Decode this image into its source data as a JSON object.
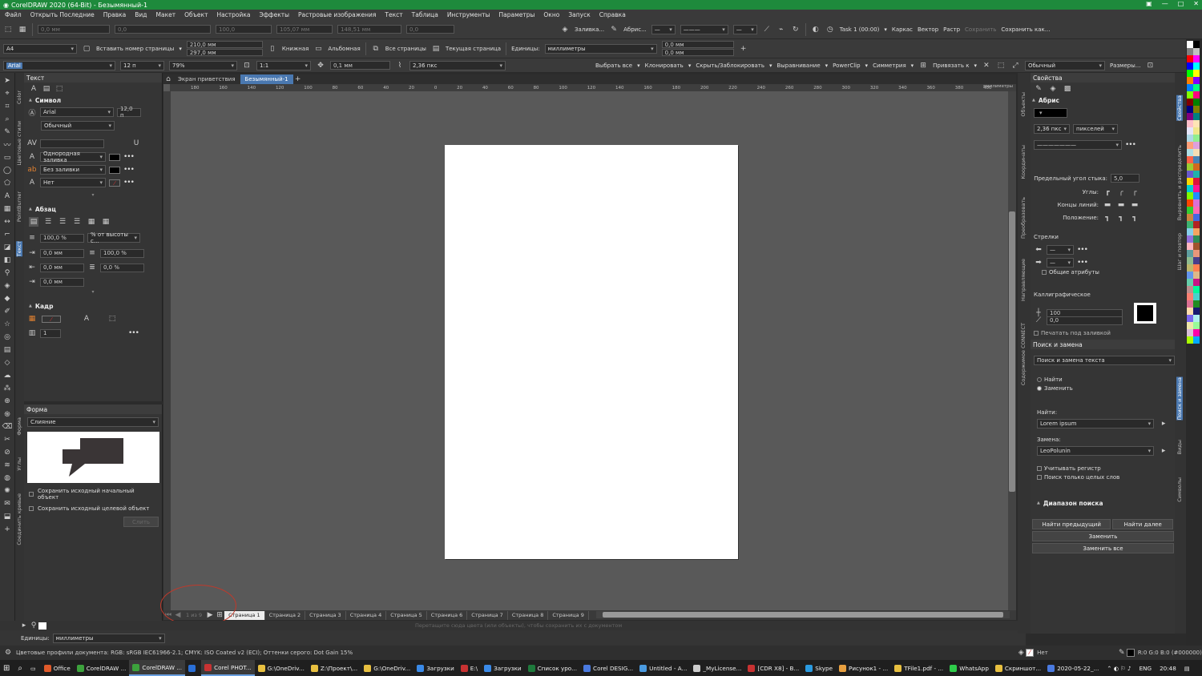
{
  "window": {
    "title": "CorelDRAW 2020 (64-Bit) - Безымянный-1"
  },
  "menu": [
    "Файл",
    "Открыть Последние",
    "Правка",
    "Вид",
    "Макет",
    "Объект",
    "Настройка",
    "Эффекты",
    "Растровые изображения",
    "Текст",
    "Таблица",
    "Инструменты",
    "Параметры",
    "Окно",
    "Запуск",
    "Справка"
  ],
  "toolbar1": {
    "fill": "Заливка...",
    "outline": "Абрис...",
    "task": "Task 1 (00:00)",
    "wireframe": "Каркас",
    "vector": "Вектор",
    "raster": "Растр",
    "save": "Сохранить",
    "save_as": "Сохранить как...",
    "x_mm": "0,0 мм",
    "w_mm": "100,0",
    "w2": "105,07 мм",
    "h2": "148,51 мм",
    "zero": "0,0"
  },
  "toolbar2": {
    "page_size": "A4",
    "insert_page_number": "Вставить номер страницы",
    "width": "210,0 мм",
    "height": "297,0 мм",
    "portrait": "Книжная",
    "landscape": "Альбомная",
    "all_pages": "Все страницы",
    "current_page": "Текущая страница",
    "units_label": "Единицы:",
    "units": "миллиметры",
    "nudge_x": "0,0 мм",
    "nudge_y": "0,0 мм"
  },
  "toolbar3": {
    "font": "Arial",
    "size": "12 п",
    "zoom": "79%",
    "scale": "1:1",
    "nudge": "0,1 мм",
    "outline_width": "2,36 пкс",
    "select_all": "Выбрать все",
    "clone": "Клонировать",
    "hide_lock": "Скрыть/Заблокировать",
    "align": "Выравнивание",
    "powerclip": "PowerClip",
    "symmetry": "Симметрия",
    "snap": "Привязать к",
    "style": "Обычный",
    "sizes": "Размеры..."
  },
  "left_panel": {
    "title": "Текст",
    "symbol": "Символ",
    "font": "Arial",
    "size": "12,0 п",
    "style": "Обычный",
    "fill1": "Однородная заливка",
    "fill2": "Без заливки",
    "fill3": "Нет",
    "paragraph": "Абзац",
    "spacing1": "100,0 %",
    "spacing_mode": "% от высоты с...",
    "indent1": "0,0 мм",
    "indent2": "0,0 мм",
    "indent3": "0,0 мм",
    "spacing2": "100,0 %",
    "spacing3": "0,0 %",
    "frame": "Кадр",
    "frame_cols": "1"
  },
  "form_panel": {
    "title": "Форма",
    "mode": "Слияние",
    "keep_source": "Сохранить исходный начальный объект",
    "keep_target": "Сохранить исходный целевой объект",
    "apply": "Слить"
  },
  "vtabs_left": [
    "Color",
    "Цветовые стили",
    "PointBurner",
    "Текст",
    "Форма",
    "Углы",
    "Соединить кривые"
  ],
  "doc_tabs": [
    "Экран приветствия",
    "Безымянный-1"
  ],
  "ruler_ticks": [
    "180",
    "160",
    "140",
    "120",
    "100",
    "80",
    "60",
    "40",
    "20",
    "0",
    "20",
    "40",
    "60",
    "80",
    "100",
    "120",
    "140",
    "160",
    "180",
    "200",
    "220",
    "240",
    "260",
    "280",
    "300",
    "320",
    "340",
    "360",
    "380",
    "400"
  ],
  "ruler_units": "миллиметры",
  "page_tabs": [
    "Страница 1",
    "Страница 2",
    "Страница 3",
    "Страница 4",
    "Страница 5",
    "Страница 6",
    "Страница 7",
    "Страница 8",
    "Страница 9"
  ],
  "page_nav": "1 из 9",
  "status_hint": "Перетащите сюда цвета (или объекты), чтобы сохранить их с документом",
  "units_row": {
    "label": "Единицы:",
    "value": "миллиметры"
  },
  "statusbar": {
    "profiles": "Цветовые профили документа: RGB: sRGB IEC61966-2.1; CMYK: ISO Coated v2 (ECI); Оттенки серого: Dot Gain 15%",
    "fill_none": "Нет",
    "color": "R:0 G:0 B:0 (#000000)"
  },
  "right_panel": {
    "title": "Свойства",
    "outline": "Абрис",
    "width": "2,36 пкс",
    "units": "пикселей",
    "miter": "Предельный угол стыка:",
    "miter_val": "5,0",
    "corners": "Углы:",
    "caps": "Концы линий:",
    "position": "Положение:",
    "arrows": "Стрелки",
    "shared": "Общие атрибуты",
    "calligraphy": "Каллиграфическое",
    "stretch": "100",
    "angle": "0,0",
    "print_under": "Печатать под заливкой"
  },
  "find_panel": {
    "title": "Поиск и замена",
    "mode": "Поиск и замена текста",
    "find": "Найти",
    "replace": "Заменить",
    "find_label": "Найти:",
    "find_value": "Lorem ipsum",
    "replace_label": "Замена:",
    "replace_value": "LeoPolunin",
    "match_case": "Учитывать регистр",
    "whole_words": "Поиск только целых слов",
    "range": "Диапазон поиска",
    "prev": "Найти предыдущий",
    "next": "Найти далее",
    "replace_btn": "Заменить",
    "replace_all": "Заменить все"
  },
  "vtabs_right": [
    "Объекты",
    "Координаты",
    "Преобразовать",
    "Направляющие",
    "Содержимое CONNECT"
  ],
  "vtabs_right2": [
    "Свойства",
    "Выровнять и распределить",
    "Шаг и повтор",
    "Поиск и замена",
    "Виды",
    "Символы"
  ],
  "palette_colors": [
    "#ffffff",
    "#000000",
    "#808080",
    "#c0c0c0",
    "#ff0000",
    "#ff00ff",
    "#0000ff",
    "#00ffff",
    "#00ff00",
    "#ffff00",
    "#ff8000",
    "#8000ff",
    "#0080ff",
    "#00ff80",
    "#80ff00",
    "#ff0080",
    "#800000",
    "#008000",
    "#000080",
    "#808000",
    "#800080",
    "#008080",
    "#ffc0cb",
    "#ffe4b5",
    "#e6e6fa",
    "#f0e68c",
    "#add8e6",
    "#90ee90",
    "#ffa07a",
    "#dda0dd",
    "#b0e0e6",
    "#f5deb3",
    "#ff6347",
    "#4682b4",
    "#9acd32",
    "#d2691e",
    "#6a5acd",
    "#20b2aa",
    "#ffd700",
    "#dc143c",
    "#00ced1",
    "#ff1493",
    "#7fff00",
    "#1e90ff",
    "#ff4500",
    "#da70d6",
    "#32cd32",
    "#ff69b4",
    "#cd853f",
    "#4169e1",
    "#3cb371",
    "#b22222",
    "#87ceeb",
    "#f4a460",
    "#9370db",
    "#2e8b57",
    "#ffb6c1",
    "#a0522d",
    "#5f9ea0",
    "#e9967a",
    "#8fbc8f",
    "#483d8b",
    "#bdb76b",
    "#ff7f50",
    "#6495ed",
    "#deb887",
    "#66cdaa",
    "#c71585",
    "#bc8f8f",
    "#00fa9a",
    "#fa8072",
    "#48d1cc",
    "#db7093",
    "#228b22",
    "#ffdead",
    "#191970",
    "#7b68ee",
    "#afeeee",
    "#eee8aa",
    "#98fb98",
    "#d8bfd8",
    "#ff00aa",
    "#aaff00",
    "#00aaff"
  ],
  "taskbar": [
    {
      "label": "Office",
      "color": "#e05a2a"
    },
    {
      "label": "CorelDRAW ...",
      "color": "#3ca23c"
    },
    {
      "label": "CorelDRAW ...",
      "color": "#3ca23c"
    },
    {
      "label": "",
      "color": "#2a6fd6"
    },
    {
      "label": "Corel PHOT...",
      "color": "#c83232"
    },
    {
      "label": "G:\\OneDriv...",
      "color": "#e8c040"
    },
    {
      "label": "Z:\\Проект\\...",
      "color": "#e8c040"
    },
    {
      "label": "G:\\OneDriv...",
      "color": "#e8c040"
    },
    {
      "label": "Загрузки",
      "color": "#3a8ae8"
    },
    {
      "label": "E:\\",
      "color": "#c83232"
    },
    {
      "label": "Загрузки",
      "color": "#3a8ae8"
    },
    {
      "label": "Список уро...",
      "color": "#1e7a3c"
    },
    {
      "label": "Corel DESIG...",
      "color": "#4a7ae0"
    },
    {
      "label": "Untitled - A...",
      "color": "#4a9ae0"
    },
    {
      "label": "_MyLicense...",
      "color": "#ccc"
    },
    {
      "label": "[CDR X8] - B...",
      "color": "#c83232"
    },
    {
      "label": "Skype",
      "color": "#2a9ae0"
    },
    {
      "label": "Рисунок1 - ...",
      "color": "#e8a040"
    },
    {
      "label": "TFile1.pdf - ...",
      "color": "#e8c040"
    },
    {
      "label": "WhatsApp",
      "color": "#2ecc4a"
    },
    {
      "label": "Скриншот...",
      "color": "#e8c040"
    },
    {
      "label": "2020-05-22_...",
      "color": "#4a7ae0"
    }
  ],
  "tray": {
    "lang": "ENG",
    "time": "20:48"
  }
}
